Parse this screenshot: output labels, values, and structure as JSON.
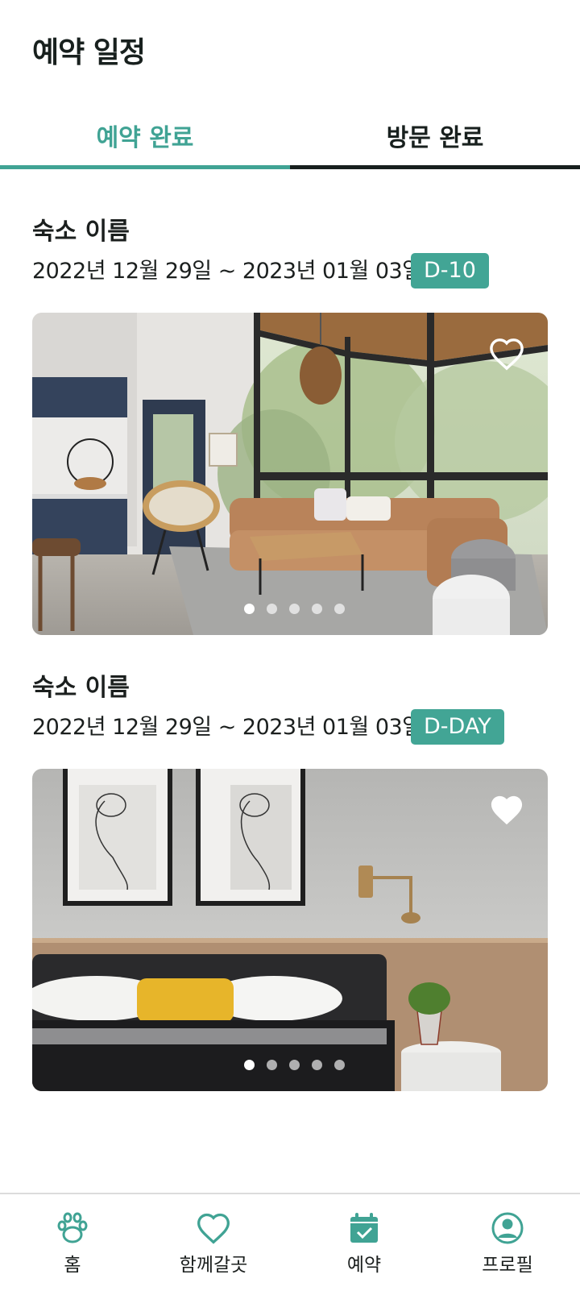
{
  "header": {
    "title": "예약 일정"
  },
  "tabs": [
    {
      "label": "예약 완료",
      "active": true
    },
    {
      "label": "방문 완료",
      "active": false
    }
  ],
  "bookings": [
    {
      "name": "숙소 이름",
      "dates": "2022년 12월 29일 ~ 2023년 01월 03일",
      "badge": "D-10",
      "photo": "living-room-photo",
      "favorited": false,
      "carousel": {
        "pages": 5,
        "current": 1
      }
    },
    {
      "name": "숙소 이름",
      "dates": "2022년 12월 29일 ~ 2023년 01월 03일",
      "badge": "D-DAY",
      "photo": "bedroom-photo",
      "favorited": true,
      "carousel": {
        "pages": 5,
        "current": 1
      }
    }
  ],
  "bottom_nav": [
    {
      "label": "홈",
      "icon": "paw-icon"
    },
    {
      "label": "함께갈곳",
      "icon": "heart-icon"
    },
    {
      "label": "예약",
      "icon": "calendar-check-icon"
    },
    {
      "label": "프로필",
      "icon": "profile-icon"
    }
  ],
  "colors": {
    "accent": "#42a595",
    "text": "#1b1f1e",
    "divider": "#dcdcdc"
  }
}
